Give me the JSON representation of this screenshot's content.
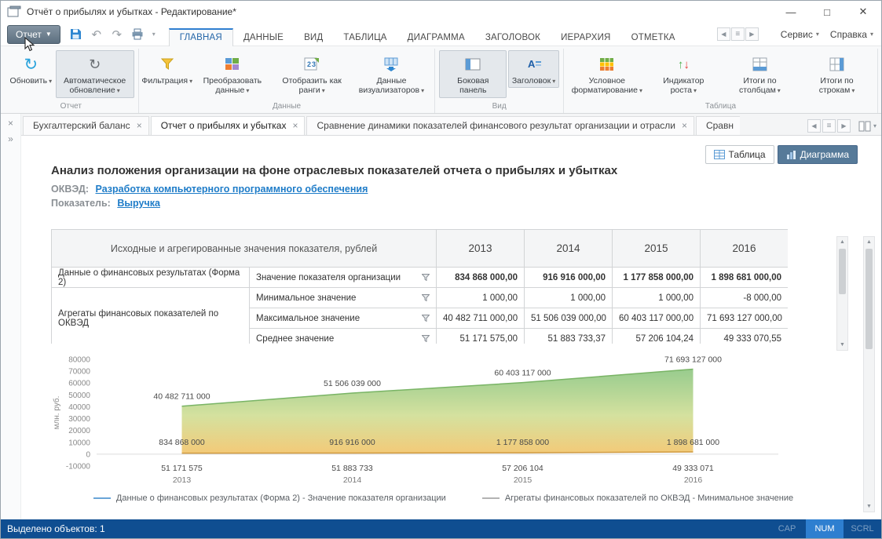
{
  "window": {
    "title": "Отчёт о прибылях и убытках - Редактирование*"
  },
  "menubar": {
    "report_button": "Отчет",
    "tabs": [
      "ГЛАВНАЯ",
      "ДАННЫЕ",
      "ВИД",
      "ТАБЛИЦА",
      "ДИАГРАММА",
      "ЗАГОЛОВОК",
      "ИЕРАРХИЯ",
      "ОТМЕТКА"
    ],
    "service_label": "Сервис",
    "help_label": "Справка"
  },
  "ribbon": {
    "groups": [
      {
        "label": "Отчет",
        "buttons": [
          {
            "label": "Обновить"
          },
          {
            "label": "Автоматическое обновление"
          }
        ]
      },
      {
        "label": "Данные",
        "buttons": [
          {
            "label": "Фильтрация"
          },
          {
            "label": "Преобразовать данные"
          },
          {
            "label": "Отобразить как ранги"
          },
          {
            "label": "Данные визуализаторов"
          }
        ]
      },
      {
        "label": "Вид",
        "buttons": [
          {
            "label": "Боковая панель"
          },
          {
            "label": "Заголовок"
          }
        ]
      },
      {
        "label": "Таблица",
        "buttons": [
          {
            "label": "Условное форматирование"
          },
          {
            "label": "Индикатор роста"
          },
          {
            "label": "Итоги по столбцам"
          },
          {
            "label": "Итоги по строкам"
          }
        ]
      }
    ]
  },
  "doc_tabs": [
    {
      "label": "Бухгалтерский баланс"
    },
    {
      "label": "Отчет о прибылях и убытках"
    },
    {
      "label": "Сравнение динамики показателей финансового результат организации и отрасли"
    },
    {
      "label": "Сравн"
    }
  ],
  "view_toggle": {
    "table_label": "Таблица",
    "chart_label": "Диаграмма"
  },
  "content": {
    "title": "Анализ положения организации на фоне отраслевых показателей отчета о прибылях и убытках",
    "okved_label": "ОКВЭД:",
    "okved_link": "Разработка компьютерного программного обеспечения",
    "indicator_label": "Показатель:",
    "indicator_link": "Выручка"
  },
  "table": {
    "title": "Исходные и агрегированные значения показателя, рублей",
    "years": [
      "2013",
      "2014",
      "2015",
      "2016"
    ],
    "group1": "Данные о финансовых результатах (Форма 2)",
    "group2": "Агрегаты финансовых показателей по ОКВЭД",
    "rows": [
      {
        "metric": "Значение показателя организации",
        "values": [
          "834 868 000,00",
          "916 916 000,00",
          "1 177 858 000,00",
          "1 898 681 000,00"
        ]
      },
      {
        "metric": "Минимальное значение",
        "values": [
          "1 000,00",
          "1 000,00",
          "1 000,00",
          "-8 000,00"
        ]
      },
      {
        "metric": "Максимальное значение",
        "values": [
          "40 482 711 000,00",
          "51 506 039 000,00",
          "60 403 117 000,00",
          "71 693 127 000,00"
        ]
      },
      {
        "metric": "Среднее значение",
        "values": [
          "51 171 575,00",
          "51 883 733,37",
          "57 206 104,24",
          "49 333 070,55"
        ]
      }
    ]
  },
  "chart_data": {
    "type": "area",
    "x": [
      "2013",
      "2014",
      "2015",
      "2016"
    ],
    "ylabel": "млн. руб.",
    "ylim": [
      -10000,
      80000
    ],
    "yticks": [
      80000,
      70000,
      60000,
      50000,
      40000,
      30000,
      20000,
      10000,
      0,
      -10000
    ],
    "grid": false,
    "series": [
      {
        "name": "Максимальное значение",
        "values_mln": [
          40482.711,
          51506.039,
          60403.117,
          71693.127
        ],
        "labels": [
          "40 482 711 000",
          "51 506 039 000",
          "60 403 117 000",
          "71 693 127 000"
        ]
      },
      {
        "name": "Значение показателя организации",
        "values_mln": [
          834.868,
          916.916,
          1177.858,
          1898.681
        ],
        "labels": [
          "834 868 000",
          "916 916 000",
          "1 177 858 000",
          "1 898 681 000"
        ]
      },
      {
        "name": "Среднее значение",
        "values_mln": [
          51.171575,
          51.883733,
          57.206104,
          49.333071
        ],
        "labels": [
          "51 171 575",
          "51 883 733",
          "57 206 104",
          "49 333 071"
        ]
      }
    ],
    "legend": [
      "Данные о финансовых результатах (Форма 2) - Значение показателя организации",
      "Агрегаты финансовых показателей по ОКВЭД - Минимальное значение"
    ],
    "legend_position": "bottom",
    "fill_colors": [
      "#7fbf72",
      "#cddc8e",
      "#f2c469"
    ]
  },
  "statusbar": {
    "selected_text": "Выделено объектов: 1",
    "cap": "CAP",
    "num": "NUM",
    "scrl": "SCRL"
  }
}
